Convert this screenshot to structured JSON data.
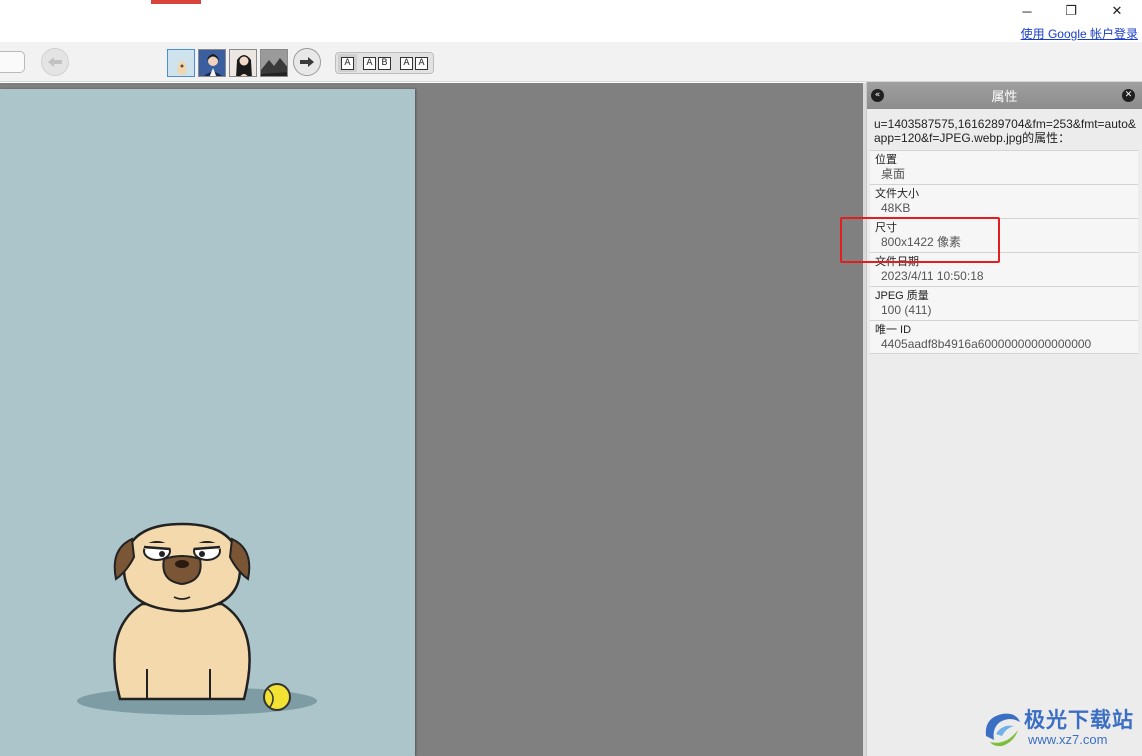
{
  "window": {
    "minimize_glyph": "─",
    "restore_glyph": "❐",
    "close_glyph": "✕",
    "google_link": "使用 Google 帐户登录"
  },
  "toolbar": {
    "thumbnails": [
      "thumbnail-pug",
      "thumbnail-portrait-1",
      "thumbnail-portrait-2",
      "thumbnail-landscape"
    ],
    "layout_buttons": [
      {
        "glyphs": [
          "A"
        ]
      },
      {
        "glyphs": [
          "A",
          "B"
        ]
      },
      {
        "glyphs": [
          "A",
          "A"
        ]
      }
    ]
  },
  "panel": {
    "title": "属性",
    "file_title": "u=1403587575,1616289704&fm=253&fmt=auto&app=120&f=JPEG.webp.jpg的属性：",
    "properties": [
      {
        "label": "位置",
        "value": "桌面"
      },
      {
        "label": "文件大小",
        "value": "48KB"
      },
      {
        "label": "尺寸",
        "value": "800x1422 像素"
      },
      {
        "label": "文件日期",
        "value": "2023/4/11 10:50:18"
      },
      {
        "label": "JPEG 质量",
        "value": "100 (411)"
      },
      {
        "label": "唯一 ID",
        "value": "4405aadf8b4916a60000000000000000"
      }
    ]
  },
  "colors": {
    "accent_red": "#d9443a",
    "highlight": "#e02020",
    "image_bg": "#acc5cb",
    "viewer_bg": "#808080",
    "link": "#1a3ec7"
  },
  "watermark": {
    "text": "极光下载站",
    "url": "www.xz7.com"
  }
}
